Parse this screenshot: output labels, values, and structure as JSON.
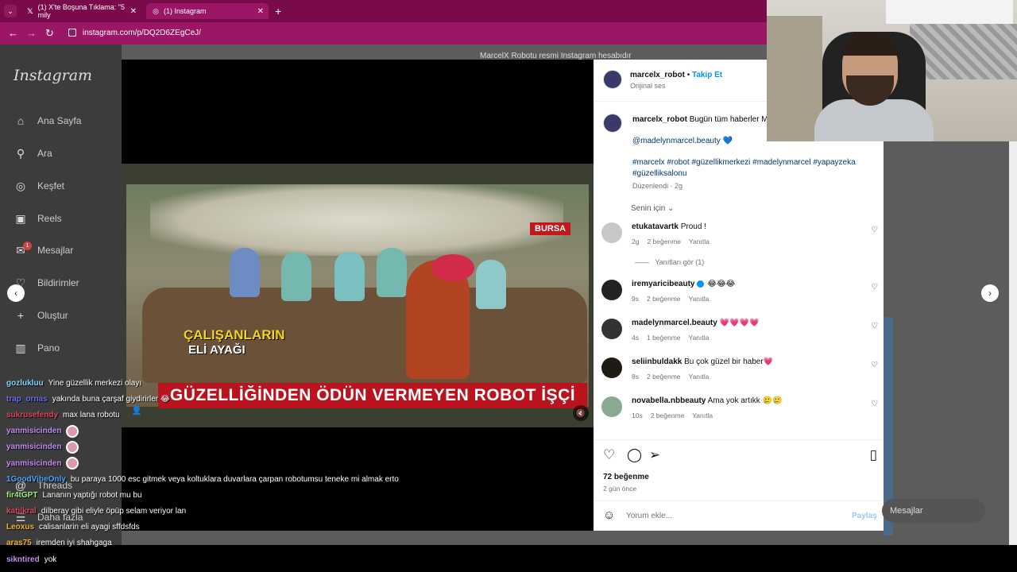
{
  "browser": {
    "tabs": [
      {
        "label": "(1) X'te Boşuna Tıklama: \"5 mily",
        "icon": "x-icon"
      },
      {
        "label": "(1) Instagram",
        "icon": "instagram-icon"
      }
    ],
    "url": "instagram.com/p/DQ2D6ZEgCeJ/"
  },
  "sidebar": {
    "logo": "Instagram",
    "items": [
      {
        "label": "Ana Sayfa",
        "icon": "home-icon"
      },
      {
        "label": "Ara",
        "icon": "search-icon"
      },
      {
        "label": "Keşfet",
        "icon": "compass-icon"
      },
      {
        "label": "Reels",
        "icon": "reels-icon"
      },
      {
        "label": "Mesajlar",
        "icon": "messenger-icon",
        "badge": "1"
      },
      {
        "label": "Bildirimler",
        "icon": "heart-icon"
      },
      {
        "label": "Oluştur",
        "icon": "plus-icon"
      },
      {
        "label": "Pano",
        "icon": "dashboard-icon"
      },
      {
        "label": "Threads",
        "icon": "threads-icon"
      },
      {
        "label": "Daha fazla",
        "icon": "menu-icon"
      }
    ]
  },
  "background_caption": "MarcelX Robotu resmi Instagram hesabıdır",
  "video": {
    "channel": "BURSA",
    "headline_top": "ÇALIŞANLARIN",
    "headline_sub": "ELİ AYAĞI",
    "band_text": "GÜZELLİĞİNDEN ÖDÜN VERMEYEN ROBOT İŞÇİ"
  },
  "post": {
    "username": "marcelx_robot",
    "follow_label": "Takip Et",
    "audio": "Orijinal ses",
    "caption_user": "marcelx_robot",
    "caption_text": "Bugün tüm haberler M",
    "mention": "@madelynmarcel.beauty 💙",
    "hashtags": "#marcelx #robot #güzellikmerkezi #madelynmarcel #yapayzeka #güzelliksalonu",
    "edited": "Düzenlendi · 2g",
    "sort_label": "Senin için",
    "comments": [
      {
        "user": "etukatavartk",
        "text": "Proud !",
        "time": "2g",
        "likes": "2 beğenme",
        "reply": "Yanıtla",
        "verified": false
      },
      {
        "user": "iremyaricibeauty",
        "text": "😂😂😂",
        "time": "9s",
        "likes": "2 beğenme",
        "reply": "Yanıtla",
        "verified": true
      },
      {
        "user": "madelynmarcel.beauty",
        "text": "💗💗💗💗",
        "time": "4s",
        "likes": "1 beğenme",
        "reply": "Yanıtla",
        "verified": false
      },
      {
        "user": "seliinbuldakk",
        "text": "Bu çok güzel bir haber💗",
        "time": "8s",
        "likes": "2 beğenme",
        "reply": "Yanıtla",
        "verified": false
      },
      {
        "user": "novabella.nbbeauty",
        "text": "Ama yok artıkk 🥲🥲",
        "time": "10s",
        "likes": "2 beğenme",
        "reply": "Yanıtla",
        "verified": false
      }
    ],
    "view_replies": "Yanıtları gör (1)",
    "likes_total": "72 beğenme",
    "posted_ago": "2 gün önce",
    "comment_placeholder": "Yorum ekle...",
    "share_label": "Paylaş"
  },
  "floating_messages": "Mesajlar",
  "chat": [
    {
      "name": "gozlukluu",
      "color": "#7fd7ff",
      "text": "Yine güzellik merkezi olayı"
    },
    {
      "name": "trap_ornas",
      "color": "#6a6cf0",
      "text": "yakında buna çarşaf giydirirler 😂"
    },
    {
      "name": "sukrusefendy",
      "color": "#e0455f",
      "text": "max lana robotu"
    },
    {
      "name": "yanmisicinden",
      "color": "#c48cf0",
      "text": "",
      "emote": true
    },
    {
      "name": "yanmisicinden",
      "color": "#c48cf0",
      "text": "",
      "emote": true
    },
    {
      "name": "yanmisicinden",
      "color": "#c48cf0",
      "text": "",
      "emote": true
    },
    {
      "name": "1GoodVibeOnly",
      "color": "#4aa5ff",
      "text": "bu paraya 1000 esc gitmek veya koltuklara duvarlara çarpan robotumsu teneke mi almak erto"
    },
    {
      "name": "fir4tGPT",
      "color": "#98f07a",
      "text": "Lananın yaptığı robot mu bu"
    },
    {
      "name": "katilkral",
      "color": "#e0455f",
      "text": "dilberay gibi eliyle öpüp selam veriyor lan"
    },
    {
      "name": "Leoxus",
      "color": "#f0b030",
      "text": "calisanlarin eli ayagi sffdsfds"
    },
    {
      "name": "aras75",
      "color": "#f0b030",
      "text": "iremden iyi shahgaga"
    },
    {
      "name": "sikntired",
      "color": "#c48cf0",
      "text": "yok"
    }
  ]
}
